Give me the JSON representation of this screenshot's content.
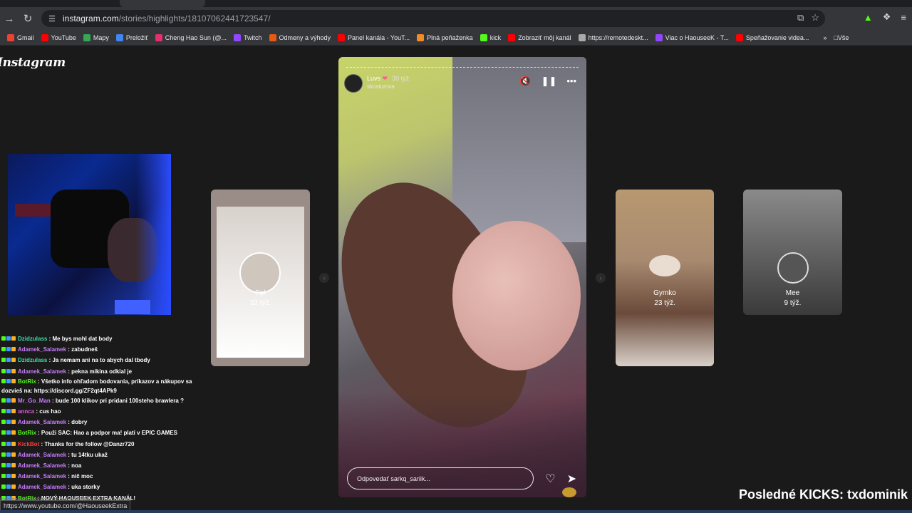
{
  "browser": {
    "url_host": "instagram.com",
    "url_path": "/stories/highlights/18107062441723547/",
    "bookmarks": [
      {
        "label": "Gmail",
        "color": "#ea4335"
      },
      {
        "label": "YouTube",
        "color": "#ff0000"
      },
      {
        "label": "Mapy",
        "color": "#34a853"
      },
      {
        "label": "Preložiť",
        "color": "#4285f4"
      },
      {
        "label": "Cheng Hao Sun (@...",
        "color": "#e1306c"
      },
      {
        "label": "Twitch",
        "color": "#9146ff"
      },
      {
        "label": "Odmeny a výhody",
        "color": "#e55b13"
      },
      {
        "label": "Panel kanála - YouT...",
        "color": "#ff0000"
      },
      {
        "label": "Plná peňaženka",
        "color": "#f28c28"
      },
      {
        "label": "kick",
        "color": "#53fc18"
      },
      {
        "label": "Zobraziť môj kanál",
        "color": "#ff0000"
      },
      {
        "label": "https://remotedeskt...",
        "color": "#aaaaaa"
      },
      {
        "label": "Viac o HaouseeK - T...",
        "color": "#9146ff"
      },
      {
        "label": "Speňažovanie videa...",
        "color": "#ff0000"
      }
    ],
    "bookmarks_more": "»",
    "all_bookmarks_label": "Vše",
    "status_url": "https://www.youtube.com/@HaouseekExtra",
    "status_url_faint": "instagram.com/stories/highlights/18086339289511565/?r=1"
  },
  "instagram": {
    "logo_text": "Instagram"
  },
  "story": {
    "username": "Luvs",
    "time": "30 týž.",
    "account": "sarkq_sariik",
    "account_display": "skosturova",
    "reply_placeholder": "Odpovedať sarkq_sariik...",
    "progress": 0.0
  },
  "highlights": [
    {
      "title": "Ppl",
      "date": "32 týž."
    },
    {
      "title": "Gymko",
      "date": "23 týž."
    },
    {
      "title": "Mee",
      "date": "9 týž."
    }
  ],
  "chat": [
    {
      "user": "Dzidzulass",
      "color": "#3fdca8",
      "text": "Me bys mohl dat body"
    },
    {
      "user": "Adamek_Salamek",
      "color": "#c97cff",
      "text": "zabudneš"
    },
    {
      "user": "Dzidzulass",
      "color": "#3fdca8",
      "text": "Ja nemam ani na to abych dal tbody"
    },
    {
      "user": "Adamek_Salamek",
      "color": "#c97cff",
      "text": "pekna mikina odkial je"
    },
    {
      "user": "BotRix",
      "color": "#53fc18",
      "text": "Všetko info ohľadom bodovania, príkazov a nákupov sa dozvieš na: https://discord.gg/ZF2qt4APk9"
    },
    {
      "user": "Mr_Go_Man",
      "color": "#c97cff",
      "text": "bude 100 klikov pri pridani 100steho brawlera ?"
    },
    {
      "user": "annca",
      "color": "#e056e0",
      "text": "cus hao"
    },
    {
      "user": "Adamek_Salamek",
      "color": "#c97cff",
      "text": "dobry"
    },
    {
      "user": "BotRix",
      "color": "#53fc18",
      "text": "Použi SAC: Hao a podpor ma! platí v EPIC GAMES"
    },
    {
      "user": "KickBot",
      "color": "#ff3b3b",
      "text": "Thanks for the follow @Danzr720"
    },
    {
      "user": "Adamek_Salamek",
      "color": "#c97cff",
      "text": "tu 14tku ukaž"
    },
    {
      "user": "Adamek_Salamek",
      "color": "#c97cff",
      "text": "noa"
    },
    {
      "user": "Adamek_Salamek",
      "color": "#c97cff",
      "text": "nič moc"
    },
    {
      "user": "Adamek_Salamek",
      "color": "#c97cff",
      "text": "uka storky"
    },
    {
      "user": "BotRix",
      "color": "#53fc18",
      "text": "NOVÝ HAOUSEEK EXTRA KANÁL!"
    }
  ],
  "overlay": {
    "kicks_text": "Posledné KICKS: txdominik"
  }
}
